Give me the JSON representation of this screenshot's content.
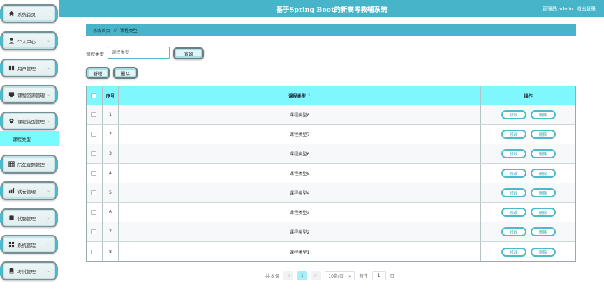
{
  "app": {
    "title": "基于Spring Boot的新高考教辅系统"
  },
  "header": {
    "user_label": "管理员 admin",
    "logout_label": "退出登录"
  },
  "sidebar": {
    "items": [
      {
        "label": "系统首页",
        "icon": "home-icon"
      },
      {
        "label": "个人中心",
        "icon": "person-icon"
      },
      {
        "label": "用户管理",
        "icon": "grid-icon"
      },
      {
        "label": "课程资源管理",
        "icon": "monitor-icon"
      },
      {
        "label": "课程类型管理",
        "icon": "location-icon"
      },
      {
        "label": "历年真题管理",
        "icon": "table-icon"
      },
      {
        "label": "试卷管理",
        "icon": "chart-icon"
      },
      {
        "label": "试题管理",
        "icon": "square-icon"
      },
      {
        "label": "系统管理",
        "icon": "grid-icon"
      },
      {
        "label": "考试管理",
        "icon": "clipboard-icon"
      }
    ],
    "active_sub": "课程类型"
  },
  "breadcrumb": {
    "home": "系统首页",
    "separator": "//",
    "current": "课程类型"
  },
  "search": {
    "label": "课程类型",
    "placeholder": "课程类型",
    "button": "查询"
  },
  "actions": {
    "add": "新增",
    "delete": "删除"
  },
  "table": {
    "headers": {
      "index": "序号",
      "type": "课程类型",
      "ops": "操作"
    },
    "rows": [
      {
        "index": "1",
        "type": "课程类型8"
      },
      {
        "index": "2",
        "type": "课程类型7"
      },
      {
        "index": "3",
        "type": "课程类型6"
      },
      {
        "index": "4",
        "type": "课程类型5"
      },
      {
        "index": "5",
        "type": "课程类型4"
      },
      {
        "index": "6",
        "type": "课程类型3"
      },
      {
        "index": "7",
        "type": "课程类型2"
      },
      {
        "index": "8",
        "type": "课程类型1"
      }
    ],
    "row_actions": {
      "edit": "修改",
      "delete": "删除"
    }
  },
  "pagination": {
    "total": "共 8 条",
    "prev": "<",
    "current": "1",
    "next": ">",
    "page_size": "10条/页",
    "goto_label": "前往",
    "goto_value": "1",
    "page_unit": "页"
  },
  "colors": {
    "header": "#47b4ca",
    "accent": "#7ef7ff",
    "active": "#77fbff"
  }
}
